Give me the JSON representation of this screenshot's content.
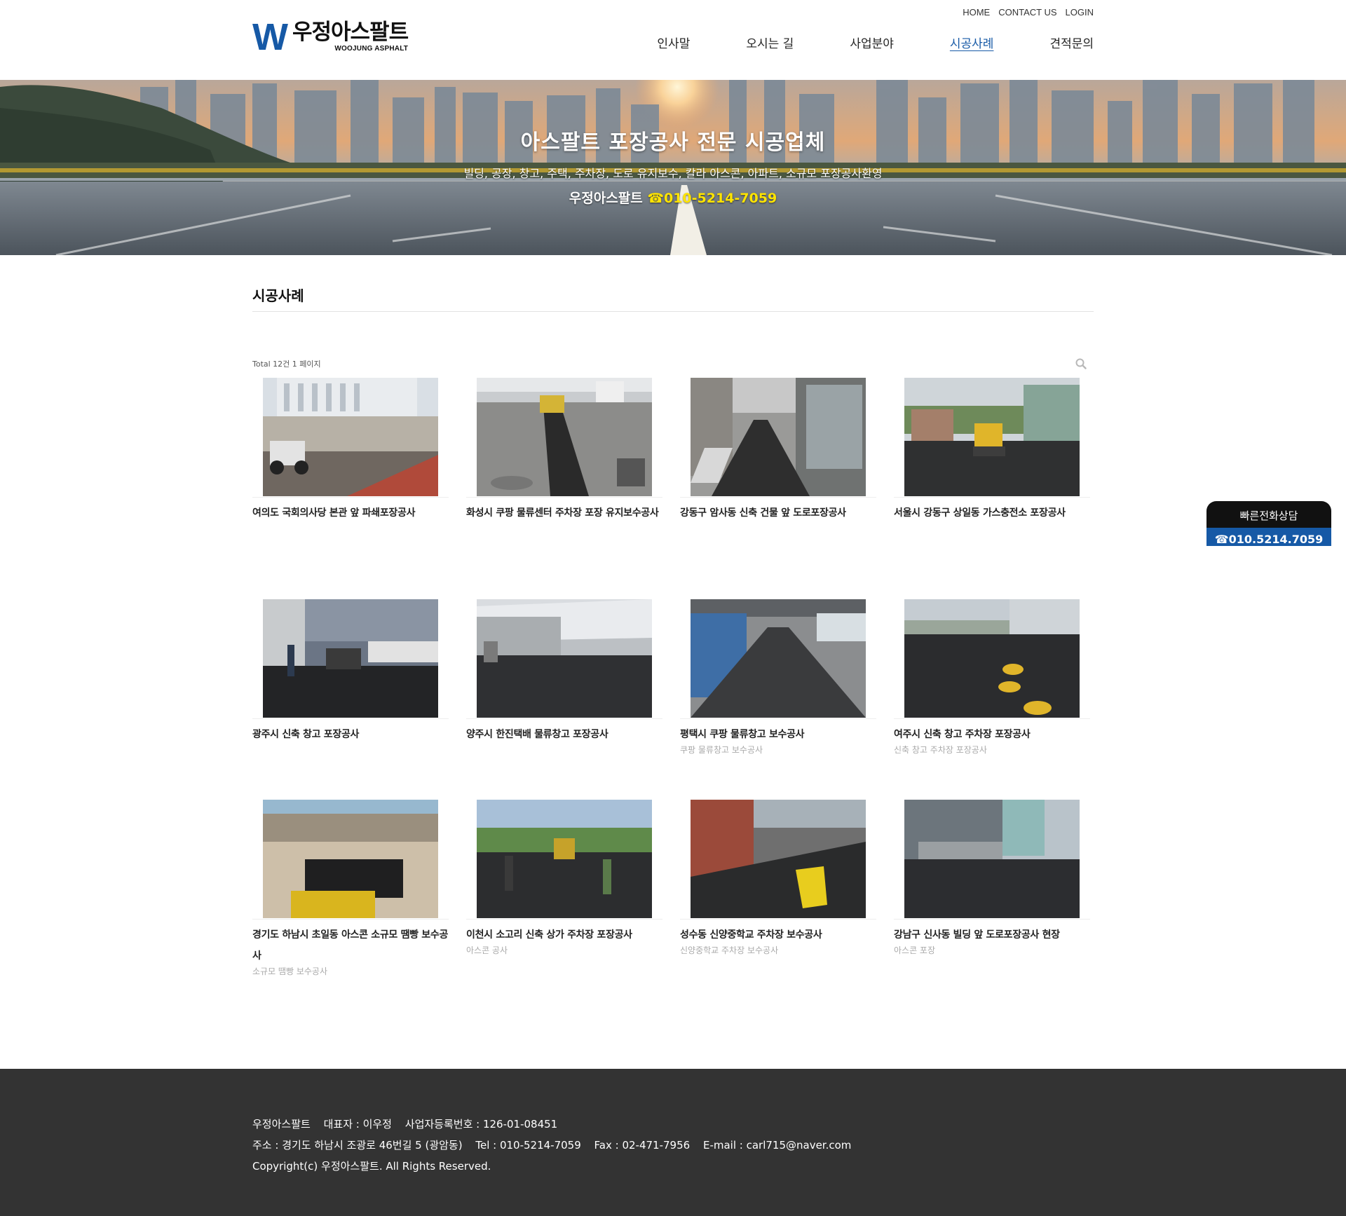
{
  "header": {
    "logo_mark": "W",
    "logo_name": "우정아스팔트",
    "logo_en": "WOOJUNG ASPHALT",
    "util": [
      "HOME",
      "CONTACT US",
      "LOGIN"
    ],
    "nav": [
      "인사말",
      "오시는 길",
      "사업분야",
      "시공사례",
      "견적문의"
    ],
    "nav_active": "시공사례"
  },
  "hero": {
    "title": "아스팔트 포장공사 전문 시공업체",
    "subtitle": "빌딩, 공장, 창고, 주택, 주차장, 도로 유지보수, 칼라 아스콘, 아파트, 소규모 포장공사환영",
    "company": "우정아스팔트",
    "phone_icon": "☎",
    "phone": "010-5214-7059"
  },
  "board": {
    "title": "시공사례",
    "total": "Total 12건 1 페이지",
    "items": [
      {
        "title": "여의도 국회의사당 본관 앞 파쇄포장공사",
        "desc": ""
      },
      {
        "title": "화성시 쿠팡 물류센터 주차장 포장 유지보수공사",
        "desc": ""
      },
      {
        "title": "강동구 암사동 신축 건물 앞 도로포장공사",
        "desc": ""
      },
      {
        "title": "서울시 강동구 상일동 가스충전소 포장공사",
        "desc": ""
      },
      {
        "title": "광주시 신축 창고 포장공사",
        "desc": ""
      },
      {
        "title": "양주시 한진택배 물류창고 포장공사",
        "desc": ""
      },
      {
        "title": "평택시 쿠팡 물류창고 보수공사",
        "desc": "쿠팡 물류창고 보수공사"
      },
      {
        "title": "여주시 신축 창고 주차장 포장공사",
        "desc": "신축 창고 주차장 포장공사"
      },
      {
        "title": "경기도 하남시 초일동 아스콘 소규모 땜빵 보수공사",
        "desc": "소규모 땜빵 보수공사"
      },
      {
        "title": "이천시 소고리 신축 상가 주차장 포장공사",
        "desc": "아스콘 공사"
      },
      {
        "title": "성수동 신양중학교 주차장 보수공사",
        "desc": "신양중학교 주차장 보수공사"
      },
      {
        "title": "강남구 신사동 빌딩 앞 도로포장공사 현장",
        "desc": "아스콘 포장"
      }
    ]
  },
  "quick_call": {
    "title": "빠른전화상담",
    "phone": "☎010.5214.7059"
  },
  "footer": {
    "company": "우정아스팔트",
    "ceo": "대표자 : 이우정",
    "biz_no": "사업자등록번호 : 126-01-08451",
    "address": "주소 : 경기도 하남시 조광로 46번길 5 (광암동)",
    "tel": "Tel : 010-5214-7059",
    "fax": "Fax : 02-471-7956",
    "email": "E-mail : carl715@naver.com",
    "copyright": "Copyright(c) 우정아스팔트. All Rights Reserved."
  },
  "colors": {
    "brand": "#1659a6",
    "phone_highlight": "#ffe400",
    "footer_bg": "#333333"
  }
}
